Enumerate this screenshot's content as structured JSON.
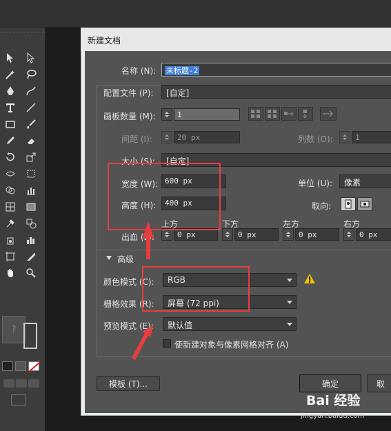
{
  "dialog": {
    "title": "新建文档",
    "name_label": "名称 (N):",
    "name_value": "未标题-2",
    "profile_label": "配置文件 (P):",
    "profile_value": "[自定]",
    "artboards_label": "画板数量 (M):",
    "artboards_value": "1",
    "spacing_label": "间距 (I):",
    "spacing_value": "20 px",
    "columns_label": "列数 (O):",
    "columns_value": "1",
    "size_label": "大小 (S):",
    "size_value": "[自定]",
    "width_label": "宽度 (W):",
    "width_value": "600 px",
    "height_label": "高度 (H):",
    "height_value": "400 px",
    "units_label": "单位 (U):",
    "units_value": "像素",
    "orientation_label": "取向:",
    "bleed_label": "出血 (L):",
    "bleed_headers": [
      "上方",
      "下方",
      "左方",
      "右方"
    ],
    "bleed_values": [
      "0 px",
      "0 px",
      "0 px",
      "0 px"
    ],
    "advanced_label": "高级",
    "color_mode_label": "颜色模式 (C):",
    "color_mode_value": "RGB",
    "raster_label": "栅格效果 (R):",
    "raster_value": "屏幕 (72 ppi)",
    "preview_label": "预览模式 (E):",
    "preview_value": "默认值",
    "align_checkbox_label": "使新建对象与像素网格对齐 (A)",
    "template_button": "模板 (T)...",
    "ok_button": "确定",
    "cancel_button": "取"
  },
  "colors": {
    "highlight_box": "#e83d3d",
    "arrow": "#e83d3d",
    "warning": "#f0c000",
    "selection": "#3f7fd6"
  },
  "watermark": {
    "brand": "Bai 经验",
    "url": "jingyan.baidu.com"
  },
  "toolbar": {
    "question": "?"
  }
}
